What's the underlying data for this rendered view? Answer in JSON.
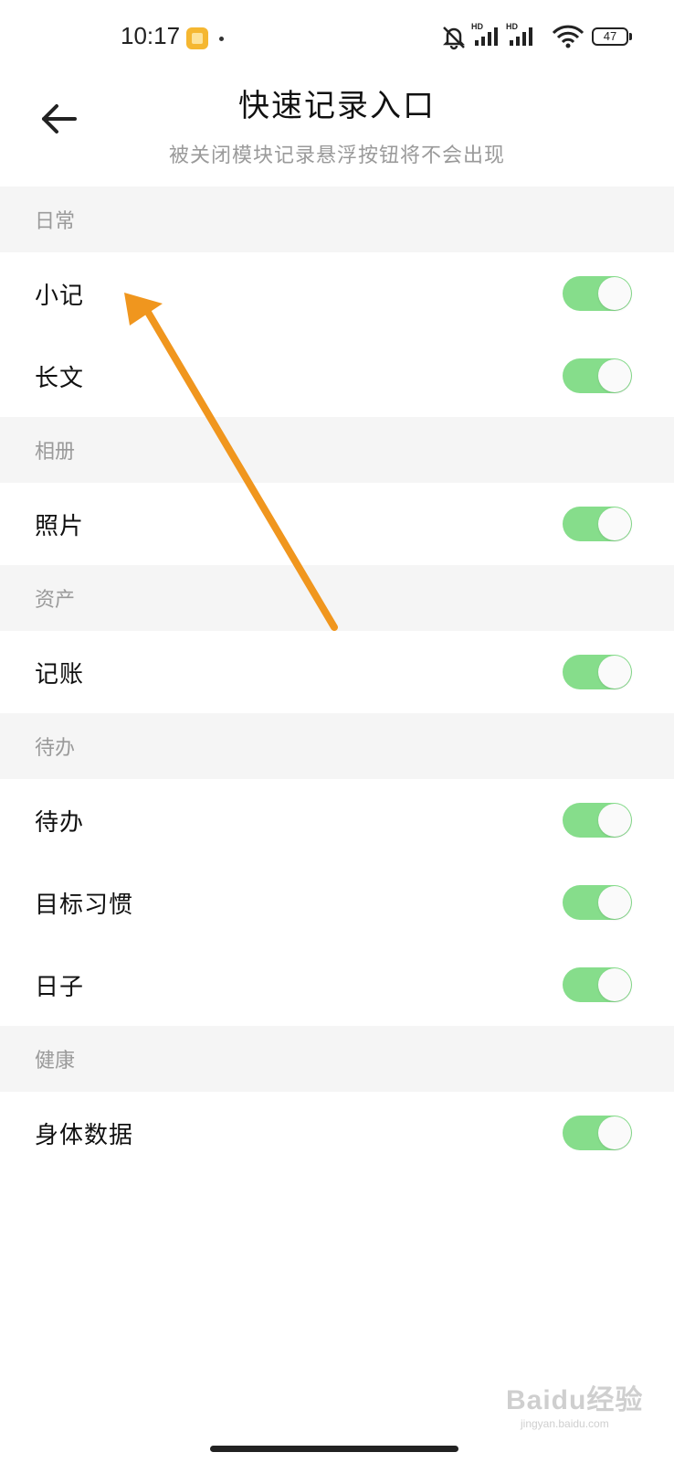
{
  "status_bar": {
    "time": "10:17",
    "battery": "47",
    "signal_badge_1": "HD",
    "signal_badge_2": "HD"
  },
  "header": {
    "title": "快速记录入口",
    "subtitle": "被关闭模块记录悬浮按钮将不会出现"
  },
  "sections": [
    {
      "title": "日常",
      "items": [
        {
          "label": "小记",
          "enabled": true
        },
        {
          "label": "长文",
          "enabled": true
        }
      ]
    },
    {
      "title": "相册",
      "items": [
        {
          "label": "照片",
          "enabled": true
        }
      ]
    },
    {
      "title": "资产",
      "items": [
        {
          "label": "记账",
          "enabled": true
        }
      ]
    },
    {
      "title": "待办",
      "items": [
        {
          "label": "待办",
          "enabled": true
        },
        {
          "label": "目标习惯",
          "enabled": true
        },
        {
          "label": "日子",
          "enabled": true
        }
      ]
    },
    {
      "title": "健康",
      "items": [
        {
          "label": "身体数据",
          "enabled": true
        }
      ]
    }
  ],
  "colors": {
    "toggle_on": "#86dd8b",
    "section_bg": "#f5f5f5",
    "annotation_arrow": "#f0961e"
  },
  "watermark": {
    "main": "Baidu经验",
    "sub": "jingyan.baidu.com"
  }
}
